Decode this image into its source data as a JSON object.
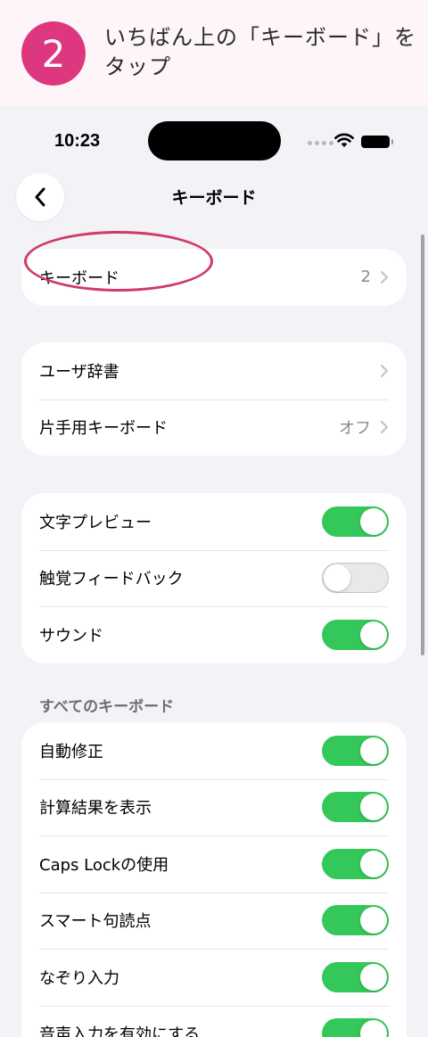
{
  "instruction": {
    "step_number": "2",
    "text": "いちばん上の「キーボード」をタップ"
  },
  "status_bar": {
    "time": "10:23"
  },
  "nav": {
    "back_icon": "chevron-left-icon",
    "title": "キーボード"
  },
  "group1": [
    {
      "label": "キーボード",
      "value": "2"
    }
  ],
  "group2": [
    {
      "label": "ユーザ辞書",
      "value": ""
    },
    {
      "label": "片手用キーボード",
      "value": "オフ"
    }
  ],
  "group3": [
    {
      "label": "文字プレビュー",
      "on": true
    },
    {
      "label": "触覚フィードバック",
      "on": false
    },
    {
      "label": "サウンド",
      "on": true
    }
  ],
  "section_header": "すべてのキーボード",
  "group4": [
    {
      "label": "自動修正",
      "on": true
    },
    {
      "label": "計算結果を表示",
      "on": true
    },
    {
      "label": "Caps Lockの使用",
      "on": true
    },
    {
      "label": "スマート句読点",
      "on": true
    },
    {
      "label": "なぞり入力",
      "on": true
    },
    {
      "label": "音声入力を有効にする",
      "on": true
    }
  ],
  "colors": {
    "accent_pink": "#dd3780",
    "toggle_on": "#34c759",
    "annotation": "#d13a64"
  }
}
